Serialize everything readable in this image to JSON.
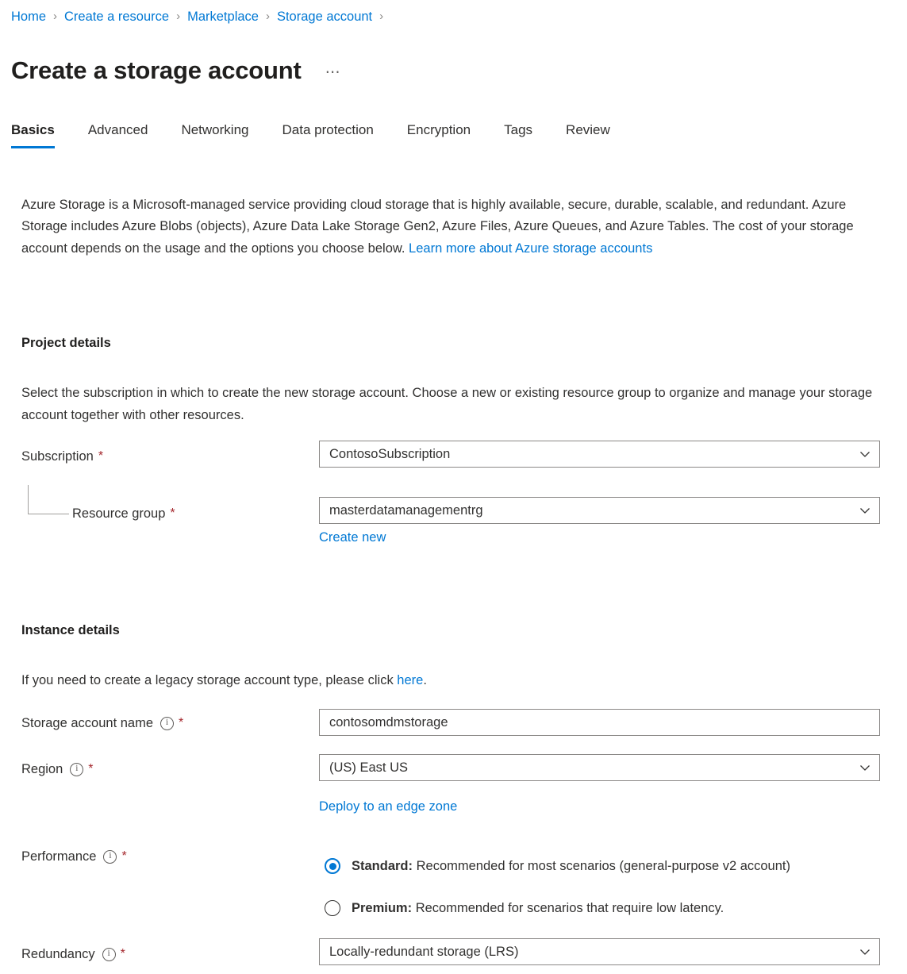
{
  "breadcrumb": {
    "separator": "›",
    "items": [
      {
        "label": "Home"
      },
      {
        "label": "Create a resource"
      },
      {
        "label": "Marketplace"
      },
      {
        "label": "Storage account"
      }
    ]
  },
  "header": {
    "title": "Create a storage account",
    "more_menu": "⋯"
  },
  "tabs": [
    {
      "label": "Basics",
      "active": true
    },
    {
      "label": "Advanced",
      "active": false
    },
    {
      "label": "Networking",
      "active": false
    },
    {
      "label": "Data protection",
      "active": false
    },
    {
      "label": "Encryption",
      "active": false
    },
    {
      "label": "Tags",
      "active": false
    },
    {
      "label": "Review",
      "active": false
    }
  ],
  "intro": {
    "text": "Azure Storage is a Microsoft-managed service providing cloud storage that is highly available, secure, durable, scalable, and redundant. Azure Storage includes Azure Blobs (objects), Azure Data Lake Storage Gen2, Azure Files, Azure Queues, and Azure Tables. The cost of your storage account depends on the usage and the options you choose below. ",
    "link": "Learn more about Azure storage accounts"
  },
  "project_details": {
    "heading": "Project details",
    "description": "Select the subscription in which to create the new storage account. Choose a new or existing resource group to organize and manage your storage account together with other resources.",
    "subscription": {
      "label": "Subscription",
      "required": "*",
      "value": "ContosoSubscription"
    },
    "resource_group": {
      "label": "Resource group",
      "required": "*",
      "value": "masterdatamanagementrg",
      "create_new_link": "Create new"
    }
  },
  "instance_details": {
    "heading": "Instance details",
    "legacy_note_prefix": "If you need to create a legacy storage account type, please click ",
    "legacy_note_link": "here",
    "legacy_note_suffix": ".",
    "storage_account_name": {
      "label": "Storage account name",
      "required": "*",
      "value": "contosomdmstorage",
      "info": "info-icon"
    },
    "region": {
      "label": "Region",
      "required": "*",
      "value": "(US) East US",
      "edge_zone_link": "Deploy to an edge zone",
      "info": "info-icon"
    },
    "performance": {
      "label": "Performance",
      "required": "*",
      "info": "info-icon",
      "options": [
        {
          "bold": "Standard:",
          "text": " Recommended for most scenarios (general-purpose v2 account)",
          "selected": true
        },
        {
          "bold": "Premium:",
          "text": " Recommended for scenarios that require low latency.",
          "selected": false
        }
      ]
    },
    "redundancy": {
      "label": "Redundancy",
      "required": "*",
      "value": "Locally-redundant storage (LRS)",
      "info": "info-icon"
    }
  },
  "colors": {
    "accent": "#0078d4",
    "required_star": "#a4262c",
    "text": "#323130",
    "border": "#8a8886"
  }
}
